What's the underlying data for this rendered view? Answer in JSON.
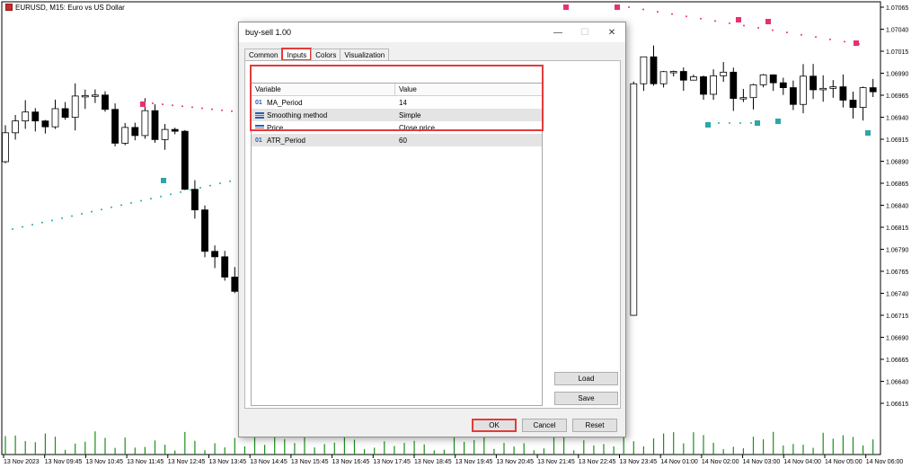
{
  "chart": {
    "title": "EURUSD, M15:  Euro vs US Dollar",
    "price_labels": [
      "1.07065",
      "1.07040",
      "1.07015",
      "1.06990",
      "1.06965",
      "1.06940",
      "1.06915",
      "1.06890",
      "1.06865",
      "1.06840",
      "1.06815",
      "1.06790",
      "1.06765",
      "1.06740",
      "1.06715",
      "1.06690",
      "1.06665",
      "1.06640",
      "1.06615"
    ],
    "time_labels": [
      "13 Nov 2023",
      "13 Nov 09:45",
      "13 Nov 10:45",
      "13 Nov 11:45",
      "13 Nov 12:45",
      "13 Nov 13:45",
      "13 Nov 14:45",
      "13 Nov 15:45",
      "13 Nov 16:45",
      "13 Nov 17:45",
      "13 Nov 18:45",
      "13 Nov 19:45",
      "13 Nov 20:45",
      "13 Nov 21:45",
      "13 Nov 22:45",
      "13 Nov 23:45",
      "14 Nov 01:00",
      "14 Nov 02:00",
      "14 Nov 03:00",
      "14 Nov 04:00",
      "14 Nov 05:00",
      "14 Nov 06:00"
    ]
  },
  "dialog": {
    "title": "buy-sell 1.00",
    "minimize": "—",
    "maximize": "☐",
    "close": "✕",
    "tabs": [
      "Common",
      "Inputs",
      "Colors",
      "Visualization"
    ],
    "grid": {
      "header_variable": "Variable",
      "header_value": "Value",
      "rows": [
        {
          "icon": "01",
          "variable": "MA_Period",
          "value": "14"
        },
        {
          "icon": "enum",
          "variable": "Smoothing method",
          "value": "Simple"
        },
        {
          "icon": "enum",
          "variable": "Price",
          "value": "Close price"
        },
        {
          "icon": "01",
          "variable": "ATR_Period",
          "value": "60"
        }
      ]
    },
    "load_label": "Load",
    "save_label": "Save",
    "ok_label": "OK",
    "cancel_label": "Cancel",
    "reset_label": "Reset"
  }
}
